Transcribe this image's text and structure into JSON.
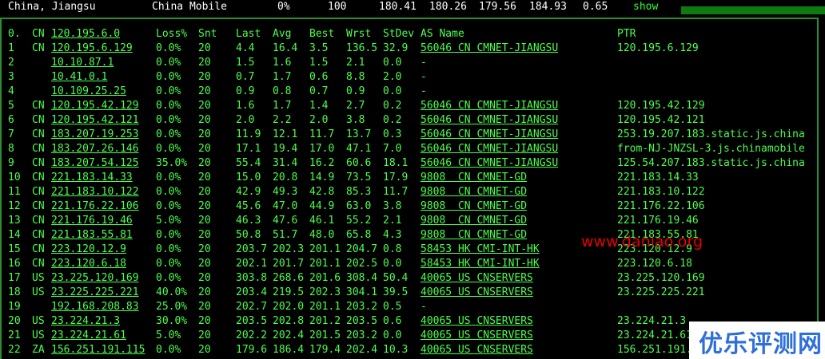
{
  "summary": {
    "location": "China, Jiangsu",
    "isp": "China Mobile",
    "loss": "0%",
    "sent": "100",
    "last": "180.41",
    "avg": "180.26",
    "best": "179.56",
    "worst": "184.93",
    "stdev": "0.65",
    "show_label": "show"
  },
  "header": {
    "hop": "0.",
    "country": "CN",
    "host": "120.195.6.0",
    "loss": "Loss%",
    "snt": "Snt",
    "last": "Last",
    "avg": "Avg",
    "best": "Best",
    "wrst": "Wrst",
    "stdev": "StDev",
    "as_name": "AS Name",
    "ptr": "PTR"
  },
  "hops": [
    {
      "hop": "1",
      "country": "CN",
      "host": "120.195.6.129",
      "loss": "0.0%",
      "snt": "20",
      "last": "4.4",
      "avg": "16.4",
      "best": "3.5",
      "wrst": "136.5",
      "stdev": "32.9",
      "as_name": "56046 CN CMNET-JIANGSU",
      "ptr": "120.195.6.129"
    },
    {
      "hop": "2",
      "country": "",
      "host": "10.10.87.1",
      "loss": "0.0%",
      "snt": "20",
      "last": "1.5",
      "avg": "1.6",
      "best": "1.5",
      "wrst": "2.1",
      "stdev": "0.0",
      "as_name": "-",
      "ptr": ""
    },
    {
      "hop": "3",
      "country": "",
      "host": "10.41.0.1",
      "loss": "0.0%",
      "snt": "20",
      "last": "0.7",
      "avg": "1.7",
      "best": "0.6",
      "wrst": "8.8",
      "stdev": "2.0",
      "as_name": "-",
      "ptr": ""
    },
    {
      "hop": "4",
      "country": "",
      "host": "10.109.25.25",
      "loss": "0.0%",
      "snt": "20",
      "last": "0.9",
      "avg": "0.8",
      "best": "0.7",
      "wrst": "0.9",
      "stdev": "0.0",
      "as_name": "-",
      "ptr": ""
    },
    {
      "hop": "5",
      "country": "CN",
      "host": "120.195.42.129",
      "loss": "0.0%",
      "snt": "20",
      "last": "1.6",
      "avg": "1.7",
      "best": "1.4",
      "wrst": "2.7",
      "stdev": "0.2",
      "as_name": "56046 CN CMNET-JIANGSU",
      "ptr": "120.195.42.129"
    },
    {
      "hop": "6",
      "country": "CN",
      "host": "120.195.42.121",
      "loss": "0.0%",
      "snt": "20",
      "last": "2.0",
      "avg": "2.2",
      "best": "2.0",
      "wrst": "3.8",
      "stdev": "0.2",
      "as_name": "56046 CN CMNET-JIANGSU",
      "ptr": "120.195.42.121"
    },
    {
      "hop": "7",
      "country": "CN",
      "host": "183.207.19.253",
      "loss": "0.0%",
      "snt": "20",
      "last": "11.9",
      "avg": "12.1",
      "best": "11.7",
      "wrst": "13.7",
      "stdev": "0.3",
      "as_name": "56046 CN CMNET-JIANGSU",
      "ptr": "253.19.207.183.static.js.china"
    },
    {
      "hop": "8",
      "country": "CN",
      "host": "183.207.26.146",
      "loss": "0.0%",
      "snt": "20",
      "last": "17.1",
      "avg": "19.4",
      "best": "17.0",
      "wrst": "47.1",
      "stdev": "7.0",
      "as_name": "56046 CN CMNET-JIANGSU",
      "ptr": "from-NJ-JNZSL-3.js.chinamobile"
    },
    {
      "hop": "9",
      "country": "CN",
      "host": "183.207.54.125",
      "loss": "35.0%",
      "snt": "20",
      "last": "55.4",
      "avg": "31.4",
      "best": "16.2",
      "wrst": "60.6",
      "stdev": "18.1",
      "as_name": "56046 CN CMNET-JIANGSU",
      "ptr": "125.54.207.183.static.js.china"
    },
    {
      "hop": "10",
      "country": "CN",
      "host": "221.183.14.33",
      "loss": "0.0%",
      "snt": "20",
      "last": "15.0",
      "avg": "20.8",
      "best": "14.9",
      "wrst": "73.5",
      "stdev": "17.9",
      "as_name": "9808  CN CMNET-GD",
      "ptr": "221.183.14.33"
    },
    {
      "hop": "11",
      "country": "CN",
      "host": "221.183.10.122",
      "loss": "0.0%",
      "snt": "20",
      "last": "42.9",
      "avg": "49.3",
      "best": "42.8",
      "wrst": "85.3",
      "stdev": "11.7",
      "as_name": "9808  CN CMNET-GD",
      "ptr": "221.183.10.122"
    },
    {
      "hop": "12",
      "country": "CN",
      "host": "221.176.22.106",
      "loss": "0.0%",
      "snt": "20",
      "last": "45.6",
      "avg": "47.0",
      "best": "44.9",
      "wrst": "63.0",
      "stdev": "3.8",
      "as_name": "9808  CN CMNET-GD",
      "ptr": "221.176.22.106"
    },
    {
      "hop": "13",
      "country": "CN",
      "host": "221.176.19.46",
      "loss": "5.0%",
      "snt": "20",
      "last": "46.3",
      "avg": "47.6",
      "best": "46.1",
      "wrst": "55.2",
      "stdev": "2.1",
      "as_name": "9808  CN CMNET-GD",
      "ptr": "221.176.19.46"
    },
    {
      "hop": "14",
      "country": "CN",
      "host": "221.183.55.81",
      "loss": "0.0%",
      "snt": "20",
      "last": "50.8",
      "avg": "51.7",
      "best": "48.0",
      "wrst": "65.8",
      "stdev": "4.3",
      "as_name": "9808  CN CMNET-GD",
      "ptr": "221.183.55.81"
    },
    {
      "hop": "15",
      "country": "CN",
      "host": "223.120.12.9",
      "loss": "0.0%",
      "snt": "20",
      "last": "203.7",
      "avg": "202.3",
      "best": "201.1",
      "wrst": "204.7",
      "stdev": "0.8",
      "as_name": "58453 HK CMI-INT-HK",
      "ptr": "223.120.12.9"
    },
    {
      "hop": "16",
      "country": "CN",
      "host": "223.120.6.18",
      "loss": "0.0%",
      "snt": "20",
      "last": "202.1",
      "avg": "201.7",
      "best": "201.1",
      "wrst": "202.5",
      "stdev": "0.0",
      "as_name": "58453 HK CMI-INT-HK",
      "ptr": "223.120.6.18"
    },
    {
      "hop": "17",
      "country": "US",
      "host": "23.225.120.169",
      "loss": "0.0%",
      "snt": "20",
      "last": "303.8",
      "avg": "268.6",
      "best": "201.6",
      "wrst": "308.4",
      "stdev": "50.4",
      "as_name": "40065 US CNSERVERS",
      "ptr": "23.225.120.169"
    },
    {
      "hop": "18",
      "country": "US",
      "host": "23.225.225.221",
      "loss": "40.0%",
      "snt": "20",
      "last": "203.4",
      "avg": "219.5",
      "best": "202.3",
      "wrst": "304.1",
      "stdev": "39.5",
      "as_name": "40065 US CNSERVERS",
      "ptr": "23.225.225.221"
    },
    {
      "hop": "19",
      "country": "",
      "host": "192.168.208.83",
      "loss": "25.0%",
      "snt": "20",
      "last": "202.7",
      "avg": "202.0",
      "best": "201.1",
      "wrst": "203.2",
      "stdev": "0.5",
      "as_name": "-",
      "ptr": ""
    },
    {
      "hop": "20",
      "country": "US",
      "host": "23.224.21.3",
      "loss": "30.0%",
      "snt": "20",
      "last": "203.5",
      "avg": "202.8",
      "best": "201.2",
      "wrst": "203.5",
      "stdev": "0.6",
      "as_name": "40065 US CNSERVERS",
      "ptr": "23.224.21.3"
    },
    {
      "hop": "21",
      "country": "US",
      "host": "23.224.21.61",
      "loss": "5.0%",
      "snt": "20",
      "last": "202.2",
      "avg": "202.4",
      "best": "201.5",
      "wrst": "203.2",
      "stdev": "0.0",
      "as_name": "40065 US CNSERVERS",
      "ptr": "23.224.21.61"
    },
    {
      "hop": "22",
      "country": "ZA",
      "host": "156.251.191.115",
      "loss": "0.0%",
      "snt": "20",
      "last": "179.6",
      "avg": "186.4",
      "best": "179.4",
      "wrst": "202.4",
      "stdev": "10.3",
      "as_name": "40065 US CNSERVERS",
      "ptr": "156.251.191.115"
    }
  ],
  "watermark": "www.daniao.org",
  "logo_text": "优乐评测网",
  "colors": {
    "text": "#4cff4c",
    "background": "#000000",
    "border": "#2f8c2f",
    "watermark": "#e60000",
    "logo": "#2f6fd8"
  }
}
